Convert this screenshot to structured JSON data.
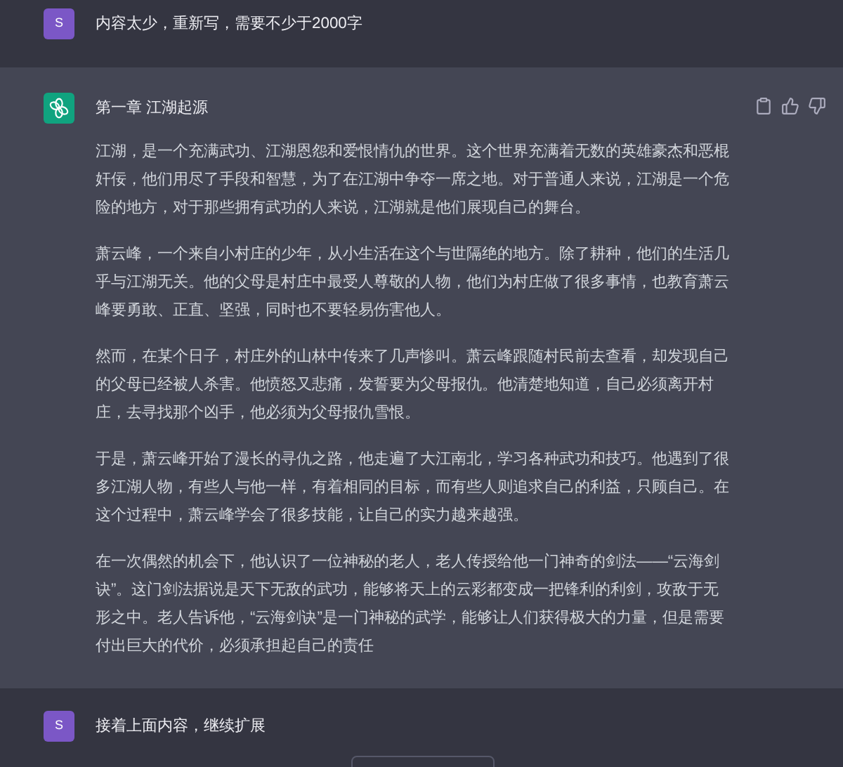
{
  "messages": [
    {
      "kind": "user",
      "avatar": "S",
      "paragraphs": [
        "内容太少，重新写，需要不少于2000字"
      ]
    },
    {
      "kind": "assistant",
      "title": "第一章 江湖起源",
      "paragraphs": [
        "江湖，是一个充满武功、江湖恩怨和爱恨情仇的世界。这个世界充满着无数的英雄豪杰和恶棍奸佞，他们用尽了手段和智慧，为了在江湖中争夺一席之地。对于普通人来说，江湖是一个危险的地方，对于那些拥有武功的人来说，江湖就是他们展现自己的舞台。",
        "萧云峰，一个来自小村庄的少年，从小生活在这个与世隔绝的地方。除了耕种，他们的生活几乎与江湖无关。他的父母是村庄中最受人尊敬的人物，他们为村庄做了很多事情，也教育萧云峰要勇敢、正直、坚强，同时也不要轻易伤害他人。",
        "然而，在某个日子，村庄外的山林中传来了几声惨叫。萧云峰跟随村民前去查看，却发现自己的父母已经被人杀害。他愤怒又悲痛，发誓要为父母报仇。他清楚地知道，自己必须离开村庄，去寻找那个凶手，他必须为父母报仇雪恨。",
        "于是，萧云峰开始了漫长的寻仇之路，他走遍了大江南北，学习各种武功和技巧。他遇到了很多江湖人物，有些人与他一样，有着相同的目标，而有些人则追求自己的利益，只顾自己。在这个过程中，萧云峰学会了很多技能，让自己的实力越来越强。",
        "在一次偶然的机会下，他认识了一位神秘的老人，老人传授给他一门神奇的剑法——“云海剑诀”。这门剑法据说是天下无敌的武功，能够将天上的云彩都变成一把锋利的利剑，攻敌于无形之中。老人告诉他，“云海剑诀”是一门神秘的武学，能够让人们获得极大的力量，但是需要付出巨大的代价，必须承担起自己的责任"
      ]
    },
    {
      "kind": "user",
      "avatar": "S",
      "paragraphs": [
        "接着上面内容，继续扩展"
      ]
    }
  ]
}
